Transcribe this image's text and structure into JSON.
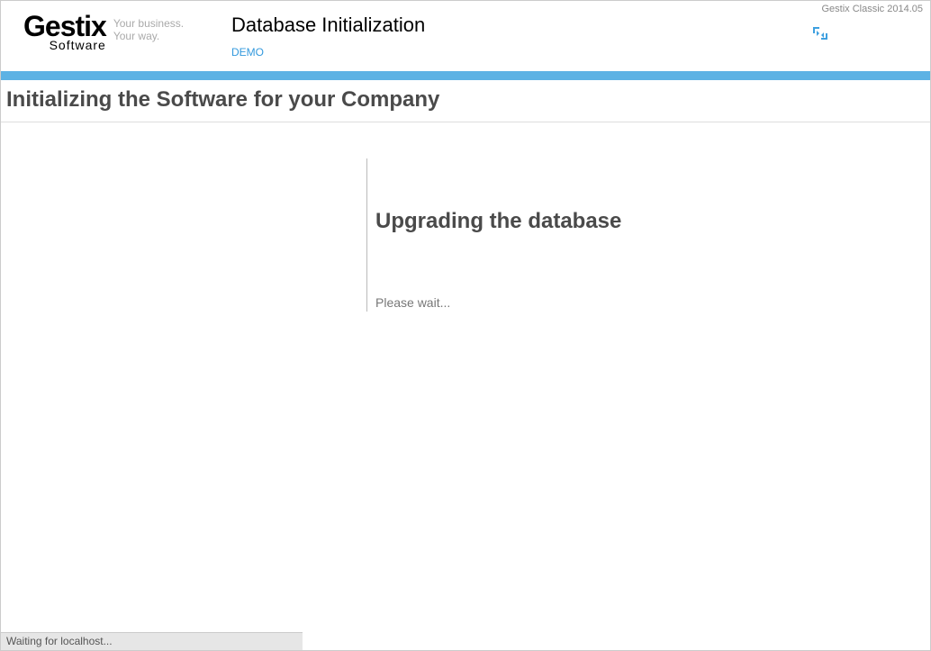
{
  "version_label": "Gestix Classic 2014.05",
  "logo": {
    "main": "Gestix",
    "sub": "Software",
    "tagline_line1": "Your business.",
    "tagline_line2": "Your way."
  },
  "page_title": "Database Initialization",
  "demo_link": "DEMO",
  "section_title": "Initializing the Software for your Company",
  "content": {
    "heading": "Upgrading the database",
    "message": "Please wait..."
  },
  "status_bar": "Waiting for localhost..."
}
